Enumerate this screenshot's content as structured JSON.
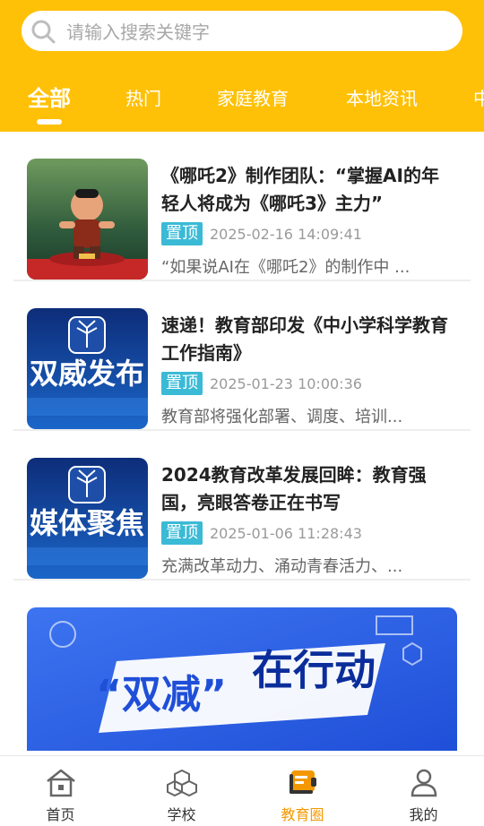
{
  "search": {
    "placeholder": "请输入搜索关键字"
  },
  "tabs": [
    {
      "label": "全部",
      "active": true
    },
    {
      "label": "热门"
    },
    {
      "label": "家庭教育"
    },
    {
      "label": "本地资讯"
    },
    {
      "label": "中"
    }
  ],
  "articles": [
    {
      "title": "《哪吒2》制作团队：“掌握AI的年轻人将成为《哪吒3》主力”",
      "badge": "置顶",
      "date": "2025-02-16 14:09:41",
      "summary": "“如果说AI在《哪吒2》的制作中 ...",
      "thumb_icon": "nezha-character-thumbnail"
    },
    {
      "title": "速递！教育部印发《中小学科学教育工作指南》",
      "badge": "置顶",
      "date": "2025-01-23 10:00:36",
      "summary": "教育部将强化部署、调度、培训...",
      "thumb_text": "双威发布"
    },
    {
      "title": "2024教育改革发展回眸：教育强国，亮眼答卷正在书写",
      "badge": "置顶",
      "date": "2025-01-06 11:28:43",
      "summary": "充满改革动力、涌动青春活力、...",
      "thumb_text": "媒体聚焦"
    }
  ],
  "banner": {
    "text_left": "“双减”",
    "text_right": "在行动"
  },
  "bottom_nav": [
    {
      "label": "首页",
      "icon": "home-icon"
    },
    {
      "label": "学校",
      "icon": "school-icon"
    },
    {
      "label": "教育圈",
      "icon": "education-circle-icon",
      "active": true
    },
    {
      "label": "我的",
      "icon": "profile-icon"
    }
  ],
  "colors": {
    "primary": "#ffc107",
    "badge": "#3bbad6",
    "active_nav": "#f39800"
  }
}
